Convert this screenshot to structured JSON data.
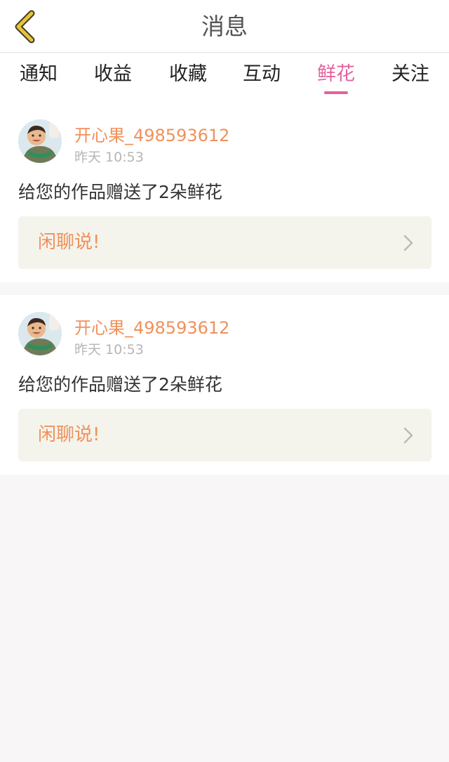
{
  "header": {
    "title": "消息",
    "back_icon": "chevron-left-icon",
    "back_icon_color": "#e8c33a"
  },
  "tabs": [
    {
      "label": "通知",
      "active": false
    },
    {
      "label": "收益",
      "active": false
    },
    {
      "label": "收藏",
      "active": false
    },
    {
      "label": "互动",
      "active": false
    },
    {
      "label": "鲜花",
      "active": true
    },
    {
      "label": "关注",
      "active": false
    }
  ],
  "colors": {
    "accent": "#e2639e",
    "username": "#f0915a",
    "chat_bar_bg": "#f4f3ec"
  },
  "messages": [
    {
      "username": "开心果_498593612",
      "time": "昨天 10:53",
      "text": "给您的作品赠送了2朵鲜花",
      "chat_label": "闲聊说!",
      "chat_icon": "chevron-right-icon"
    },
    {
      "username": "开心果_498593612",
      "time": "昨天 10:53",
      "text": "给您的作品赠送了2朵鲜花",
      "chat_label": "闲聊说!",
      "chat_icon": "chevron-right-icon"
    }
  ]
}
